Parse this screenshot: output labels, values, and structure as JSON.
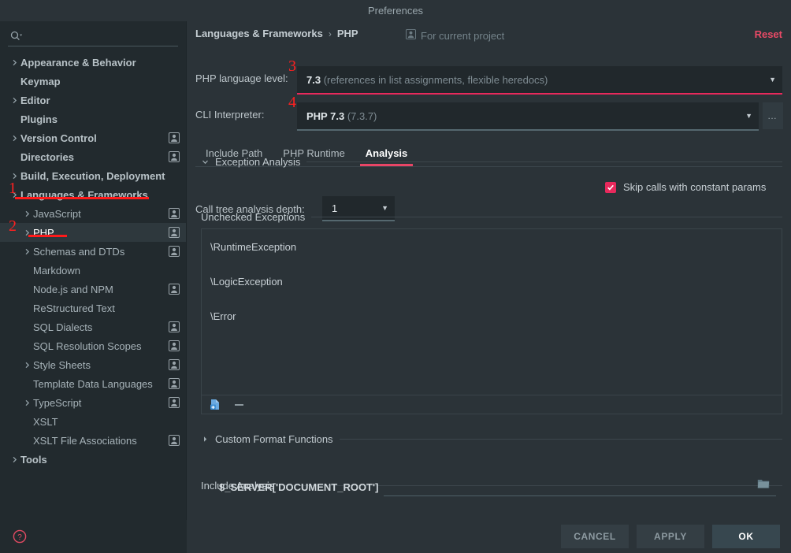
{
  "window": {
    "title": "Preferences"
  },
  "search": {
    "value": "",
    "placeholder": "",
    "icon": "search-icon"
  },
  "sidebar": {
    "items": [
      {
        "label": "Appearance & Behavior",
        "level": 0,
        "arrow": "collapsed",
        "badge": false,
        "bold": true
      },
      {
        "label": "Keymap",
        "level": 0,
        "arrow": "none",
        "badge": false,
        "bold": true
      },
      {
        "label": "Editor",
        "level": 0,
        "arrow": "collapsed",
        "badge": false,
        "bold": true
      },
      {
        "label": "Plugins",
        "level": 0,
        "arrow": "none",
        "badge": false,
        "bold": true
      },
      {
        "label": "Version Control",
        "level": 0,
        "arrow": "collapsed",
        "badge": true,
        "bold": true
      },
      {
        "label": "Directories",
        "level": 0,
        "arrow": "none",
        "badge": true,
        "bold": true
      },
      {
        "label": "Build, Execution, Deployment",
        "level": 0,
        "arrow": "collapsed",
        "badge": false,
        "bold": true
      },
      {
        "label": "Languages & Frameworks",
        "level": 0,
        "arrow": "collapsed",
        "badge": false,
        "bold": true
      },
      {
        "label": "JavaScript",
        "level": 1,
        "arrow": "collapsed",
        "badge": true,
        "bold": false
      },
      {
        "label": "PHP",
        "level": 1,
        "arrow": "collapsed",
        "badge": true,
        "bold": false,
        "selected": true
      },
      {
        "label": "Schemas and DTDs",
        "level": 1,
        "arrow": "collapsed",
        "badge": true,
        "bold": false
      },
      {
        "label": "Markdown",
        "level": 1,
        "arrow": "none",
        "badge": false,
        "bold": false
      },
      {
        "label": "Node.js and NPM",
        "level": 1,
        "arrow": "none",
        "badge": true,
        "bold": false
      },
      {
        "label": "ReStructured Text",
        "level": 1,
        "arrow": "none",
        "badge": false,
        "bold": false
      },
      {
        "label": "SQL Dialects",
        "level": 1,
        "arrow": "none",
        "badge": true,
        "bold": false
      },
      {
        "label": "SQL Resolution Scopes",
        "level": 1,
        "arrow": "none",
        "badge": true,
        "bold": false
      },
      {
        "label": "Style Sheets",
        "level": 1,
        "arrow": "collapsed",
        "badge": true,
        "bold": false
      },
      {
        "label": "Template Data Languages",
        "level": 1,
        "arrow": "none",
        "badge": true,
        "bold": false
      },
      {
        "label": "TypeScript",
        "level": 1,
        "arrow": "collapsed",
        "badge": true,
        "bold": false
      },
      {
        "label": "XSLT",
        "level": 1,
        "arrow": "none",
        "badge": false,
        "bold": false
      },
      {
        "label": "XSLT File Associations",
        "level": 1,
        "arrow": "none",
        "badge": true,
        "bold": false
      },
      {
        "label": "Tools",
        "level": 0,
        "arrow": "collapsed",
        "badge": false,
        "bold": true
      }
    ],
    "help_icon": "help-circle-icon"
  },
  "annotations": [
    {
      "number": "1",
      "target": "Languages & Frameworks"
    },
    {
      "number": "2",
      "target": "PHP"
    },
    {
      "number": "3",
      "target": "PHP language level"
    },
    {
      "number": "4",
      "target": "CLI Interpreter"
    }
  ],
  "header": {
    "breadcrumb": [
      "Languages & Frameworks",
      "PHP"
    ],
    "separator": "›",
    "scope_icon": "person-icon",
    "scope_label": "For current project",
    "reset_label": "Reset"
  },
  "fields": {
    "language_level": {
      "label": "PHP language level:",
      "value_main": "7.3",
      "value_dim": "(references in list assignments, flexible heredocs)",
      "caret": "▼",
      "underline_color": "#e8295c"
    },
    "cli_interpreter": {
      "label": "CLI Interpreter:",
      "value_main": "PHP 7.3",
      "value_dim": "(7.3.7)",
      "caret": "▼",
      "underline_color": "#55686f",
      "more_button": "…"
    }
  },
  "tabs": [
    {
      "label": "Include Path",
      "active": false
    },
    {
      "label": "PHP Runtime",
      "active": false
    },
    {
      "label": "Analysis",
      "active": true
    }
  ],
  "exception_analysis": {
    "section_title": "Exception Analysis",
    "expanded": true,
    "depth_label": "Call tree analysis depth:",
    "depth_value": "1",
    "depth_caret": "▼",
    "skip_label": "Skip calls with constant params",
    "skip_checked": true,
    "checkbox_color": "#e8295c"
  },
  "unchecked_exceptions": {
    "section_title": "Unchecked Exceptions",
    "items": [
      "\\RuntimeException",
      "\\LogicException",
      "\\Error"
    ],
    "toolbar": {
      "add_icon": "add-file-icon",
      "remove_icon": "minus-icon"
    }
  },
  "custom_format_functions": {
    "section_title": "Custom Format Functions",
    "expanded": false
  },
  "include_analysis": {
    "section_title": "Include Analysis",
    "path_label": "$_SERVER['DOCUMENT_ROOT']",
    "path_value": "",
    "browse_icon": "folder-icon"
  },
  "footer": {
    "cancel_label": "CANCEL",
    "apply_label": "APPLY",
    "ok_label": "OK"
  }
}
